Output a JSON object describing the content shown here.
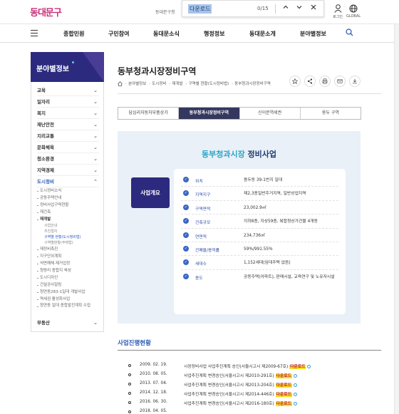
{
  "header": {
    "logo": "동대문구",
    "gov_text": "동대문구청"
  },
  "find_bar": {
    "query": "다운로드",
    "count": "0/15"
  },
  "top_icons": {
    "login_label": "로그인",
    "global_label": "GLOBAL"
  },
  "nav": {
    "items": [
      "종합민원",
      "구민참여",
      "동대문소식",
      "행정정보",
      "동대문소개",
      "분야별정보"
    ]
  },
  "sidebar": {
    "title": "분야별정보",
    "items": [
      {
        "label": "교육"
      },
      {
        "label": "일자리"
      },
      {
        "label": "복지"
      },
      {
        "label": "재난안전"
      },
      {
        "label": "지리교통"
      },
      {
        "label": "문화체육"
      },
      {
        "label": "청소환경"
      },
      {
        "label": "지역경제"
      },
      {
        "label": "도시정비"
      }
    ],
    "sub_items": [
      "도시정비소식",
      "공동주택안내",
      "정비사업구역현황",
      "재건축",
      "재개발"
    ],
    "sub_sub_items": [
      "사업안내",
      "추진절차",
      "구역별 현황(도시정비법)",
      "구역별현황(주택법)"
    ],
    "sub_items_after": [
      "재정비촉진",
      "지구단위계획",
      "석면해체·제거업정",
      "청량리 종합지 육성",
      "도시디자인",
      "건설공사알림",
      "청연동283-1일대 개발사업",
      "역세권 활성화사업",
      "청연동 일대 종합발전계획 수립"
    ],
    "last_item": "부동산"
  },
  "page": {
    "title": "동부청과시장정비구역",
    "breadcrumb": [
      "분야별정보",
      "도시정비",
      "재개발",
      "구역별 현황(도시정비법)",
      "동부청과시장정비구역"
    ],
    "tabs": [
      {
        "label": "답십리자동차부품상가",
        "active": false
      },
      {
        "label": "동부청과시장정비구역",
        "active": true
      },
      {
        "label": "신이문역세권",
        "active": false
      },
      {
        "label": "용두 구역",
        "active": false
      }
    ]
  },
  "panel": {
    "title_highlight": "동부청과시장",
    "title_rest": "정비사업",
    "badge": "사업개요",
    "rows": [
      {
        "key": "위치",
        "value": "용두동 39-1번지 일대"
      },
      {
        "key": "지역지구",
        "value": "제2,3종일반주거지역, 일반상업지역"
      },
      {
        "key": "구역면적",
        "value": "23,002.9㎡"
      },
      {
        "key": "건축규모",
        "value": "지하8층, 지상59층, 복합청상가건물 4개동"
      },
      {
        "key": "연면적",
        "value": "234,736㎡"
      },
      {
        "key": "건폐율/용적률",
        "value": "59%/991.55%"
      },
      {
        "key": "세대수",
        "value": "1,152세대(임대주택 없음)"
      },
      {
        "key": "용도",
        "value": "공동주택(아파트), 판매시설, 교육연구 및 노유자시설"
      }
    ]
  },
  "history": {
    "title": "사업진행현황",
    "download_label": "다운로드",
    "rows": [
      {
        "date": "2009. 02. 19.",
        "text": "시장정비사업 사업추진계획 승인(서울시고시 제2009-67호)"
      },
      {
        "date": "2010. 08. 05.",
        "text": "사업추진계획 변경승인(서울시고시 제2010-291호)"
      },
      {
        "date": "2013. 07. 04.",
        "text": "사업추진계획 변경승인(서울시고시 제2013-204호)"
      },
      {
        "date": "2014. 12. 18.",
        "text": "사업추진계획 변경승인(서울시고시 제2014-446호)"
      },
      {
        "date": "2016. 06. 30.",
        "text": "사업추진계획 변경승인(서울시고시 제2016-180호)"
      },
      {
        "date": "2018. 04. 05.",
        "text": ""
      }
    ]
  },
  "colors": {
    "primary": "#2c2a7e",
    "accent": "#2aa6c9",
    "highlight": "#f5e21a",
    "link": "#2a5bb5"
  }
}
